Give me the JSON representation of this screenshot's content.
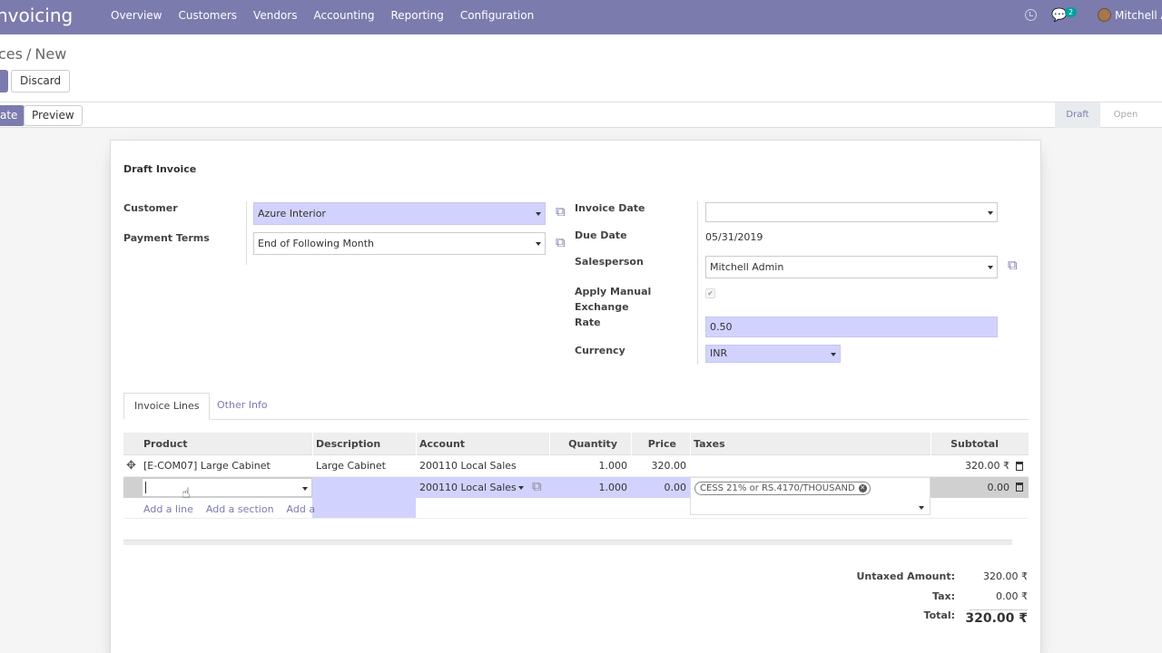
{
  "navbar": {
    "app_name": "nvoicing",
    "menu": [
      "Overview",
      "Customers",
      "Vendors",
      "Accounting",
      "Reporting",
      "Configuration"
    ],
    "messages_count": "2",
    "user_name": "Mitchell A",
    "icons": [
      "clock-icon",
      "chat-icon",
      "avatar"
    ]
  },
  "breadcrumb": {
    "parent": "ces",
    "separator": "/",
    "current": "New"
  },
  "actions": {
    "discard": "Discard",
    "validate": "ate",
    "preview": "Preview"
  },
  "status": {
    "stages": [
      "Draft",
      "Open"
    ],
    "active": "Draft"
  },
  "form": {
    "title": "Draft Invoice",
    "customer_label": "Customer",
    "customer_value": "Azure Interior",
    "payment_terms_label": "Payment Terms",
    "payment_terms_value": "End of Following Month",
    "invoice_date_label": "Invoice Date",
    "invoice_date_value": "",
    "due_date_label": "Due Date",
    "due_date_value": "05/31/2019",
    "salesperson_label": "Salesperson",
    "salesperson_value": "Mitchell Admin",
    "manual_rate_label_1": "Apply Manual",
    "manual_rate_label_2": "Exchange",
    "manual_rate_label_3": "Rate",
    "manual_rate_checked": true,
    "manual_rate_value": "0.50",
    "currency_label": "Currency",
    "currency_value": "INR"
  },
  "tabs": [
    "Invoice Lines",
    "Other Info"
  ],
  "table": {
    "headers": [
      "Product",
      "Description",
      "Account",
      "Quantity",
      "Price",
      "Taxes",
      "Subtotal"
    ],
    "rows": [
      {
        "product": "[E-COM07] Large Cabinet",
        "description": "Large Cabinet",
        "account": "200110 Local Sales",
        "quantity": "1.000",
        "price": "320.00",
        "taxes": "",
        "subtotal": "320.00 ₹"
      },
      {
        "product": "",
        "description": "",
        "account": "200110 Local Sales",
        "quantity": "1.000",
        "price": "0.00",
        "taxes": "CESS 21% or RS.4170/THOUSAND",
        "subtotal": "0.00"
      }
    ],
    "add_links": [
      "Add a line",
      "Add a section",
      "Add a"
    ]
  },
  "totals": {
    "untaxed_label": "Untaxed Amount:",
    "untaxed_value": "320.00 ₹",
    "tax_label": "Tax:",
    "tax_value": "0.00 ₹",
    "total_label": "Total:",
    "total_value": "320.00 ₹"
  },
  "colors": {
    "brand": "#7c7bad",
    "required_field": "#d2d2ff"
  }
}
